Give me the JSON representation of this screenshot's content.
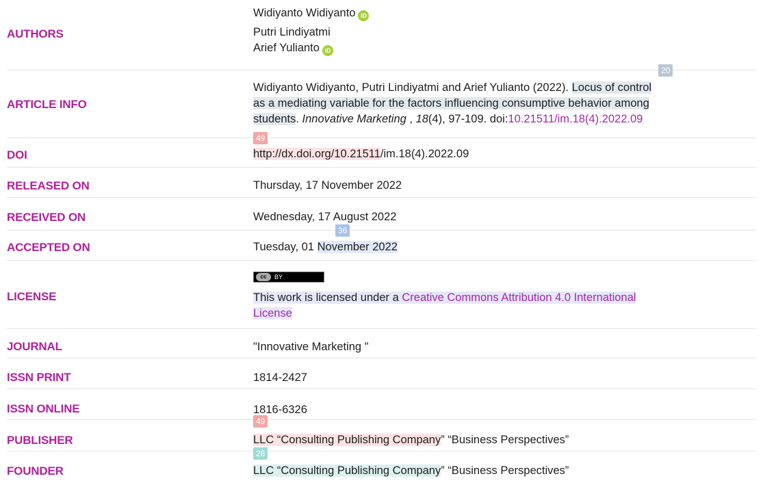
{
  "rows": {
    "authors": {
      "label": "AUTHORS",
      "names": [
        "Widiyanto Widiyanto",
        "Putri Lindiyatmi",
        "Arief Yulianto"
      ],
      "orcid_icon_text": "iD"
    },
    "article_info": {
      "label": "ARTICLE INFO",
      "citation_prefix": "Widiyanto Widiyanto, Putri Lindiyatmi and Arief Yulianto (2022). ",
      "title_line1": "Locus of control",
      "title_line2": "as a mediating variable for the factors influencing consumptive behavior among",
      "title_line3": "students",
      "sep1": ". ",
      "journal_italic": "Innovative Marketing",
      "sep2": " , ",
      "volume_italic": "18",
      "issue_pages": "(4), 97-109. doi:",
      "doi_link": "10.21511/im.18(4).2022.09"
    },
    "doi": {
      "label": "DOI",
      "url_part1": "http://dx.doi.org/10.21511",
      "url_part2": "/im.18(4).2022.09"
    },
    "released": {
      "label": "RELEASED ON",
      "value": "Thursday, 17 November 2022"
    },
    "received": {
      "label": "RECEIVED ON",
      "value": "Wednesday, 17 August 2022"
    },
    "accepted": {
      "label": "ACCEPTED ON",
      "value_prefix": "Tuesday, 01 ",
      "value_hl": "November 2022"
    },
    "license": {
      "label": "LICENSE",
      "badge_cc": "cc",
      "badge_by": "BY",
      "text_prefix": "This work is licensed under a ",
      "link_line1": "Creative Commons Attribution 4.0 International",
      "link_line2": "License"
    },
    "journal": {
      "label": "JOURNAL",
      "value": "\"Innovative Marketing \""
    },
    "issn_print": {
      "label": "ISSN PRINT",
      "value": "1814-2427"
    },
    "issn_online": {
      "label": "ISSN ONLINE",
      "value": "1816-6326"
    },
    "publisher": {
      "label": "PUBLISHER",
      "value_hl": "LLC “Consulting Publishing Company",
      "value_rest": "” “Business Perspectives”"
    },
    "founder": {
      "label": "FOUNDER",
      "value_hl": "LLC “Consulting Publishing Company",
      "value_rest": "” “Business Perspectives”"
    }
  },
  "badges": {
    "b20": "20",
    "b49a": "49",
    "b36": "36",
    "b49b": "49",
    "b28": "28"
  },
  "colors": {
    "label": "#b3209e",
    "link": "#a526b1",
    "orcid": "#a6ce39"
  }
}
